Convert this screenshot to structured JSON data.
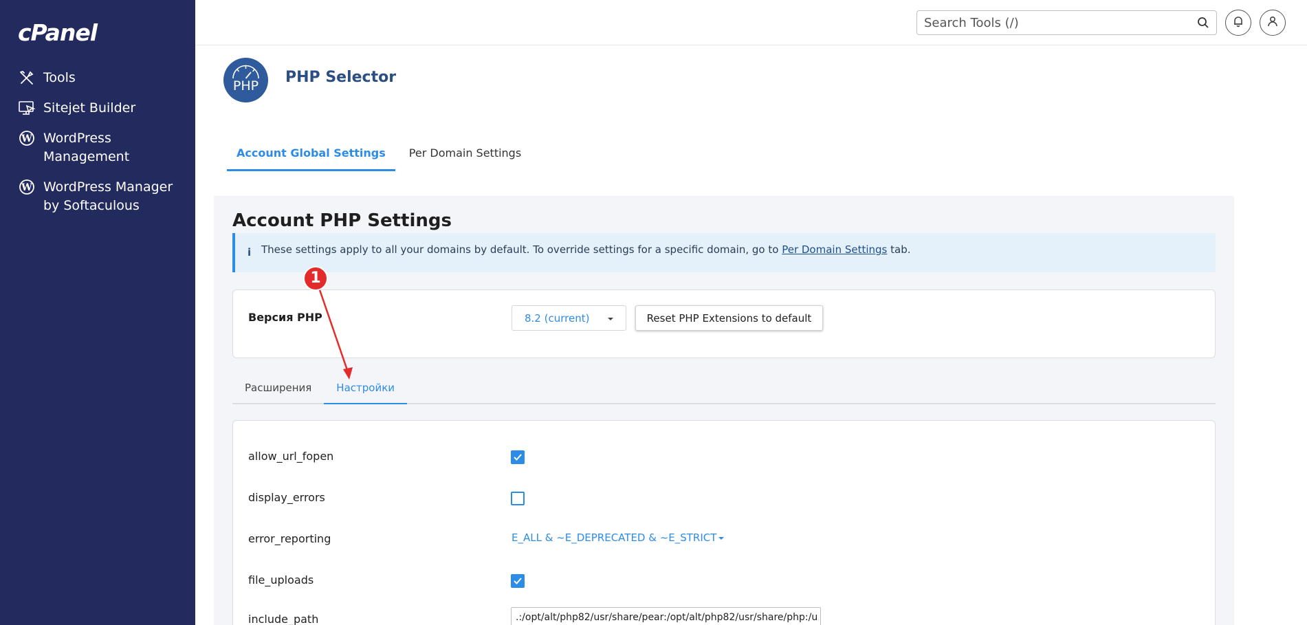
{
  "brand": {
    "logo_text": "cPanel"
  },
  "sidebar": {
    "items": [
      {
        "label": "Tools",
        "icon": "tools-icon"
      },
      {
        "label": "Sitejet Builder",
        "icon": "sitejet-icon"
      },
      {
        "label": "WordPress Management",
        "icon": "wordpress-icon"
      },
      {
        "label": "WordPress Manager by Softaculous",
        "icon": "wordpress-icon"
      }
    ]
  },
  "topbar": {
    "search_placeholder": "Search Tools (/)",
    "icons": [
      "search-icon",
      "bell-icon",
      "user-icon"
    ]
  },
  "page": {
    "logo_text": "PHP",
    "title": "PHP Selector",
    "tabs": [
      {
        "label": "Account Global Settings",
        "active": true
      },
      {
        "label": "Per Domain Settings",
        "active": false
      }
    ]
  },
  "account": {
    "title": "Account PHP Settings",
    "info_text": "These settings apply to all your domains by default. To override settings for a specific domain, go to",
    "info_link": "Per Domain Settings",
    "info_suffix": "tab.",
    "version_label": "Версия PHP",
    "version_value": "8.2 (current)",
    "reset_button": "Reset PHP Extensions to default",
    "tabs": [
      {
        "label": "Расширения",
        "active": false
      },
      {
        "label": "Настройки",
        "active": true
      }
    ]
  },
  "settings": {
    "rows": [
      {
        "name": "allow_url_fopen",
        "type": "checkbox",
        "checked": true
      },
      {
        "name": "display_errors",
        "type": "checkbox",
        "checked": false
      },
      {
        "name": "error_reporting",
        "type": "select",
        "value": "E_ALL & ~E_DEPRECATED & ~E_STRICT"
      },
      {
        "name": "file_uploads",
        "type": "checkbox",
        "checked": true
      },
      {
        "name": "include_path",
        "type": "text",
        "value": ".:/opt/alt/php82/usr/share/pear:/opt/alt/php82/usr/share/php:/u"
      }
    ]
  },
  "annotation": {
    "badge": "1",
    "color": "#e42b2b"
  },
  "colors": {
    "sidebar": "#232b5e",
    "accent": "#2d8ce6",
    "title": "#2c4f83",
    "panel": "#f4f5f8"
  }
}
